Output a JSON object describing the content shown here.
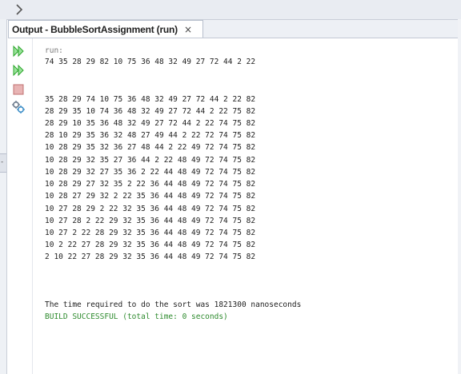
{
  "toolbar_top": {
    "chevron_icon": "chevron-right-icon"
  },
  "tab": {
    "label": "Output - BubbleSortAssignment (run)",
    "close": "×"
  },
  "side_toolbar": {
    "buttons": [
      {
        "icon": "rerun-icon",
        "color": "#2aa52a"
      },
      {
        "icon": "rerun-with-options-icon",
        "color": "#2aa52a"
      },
      {
        "icon": "stop-icon",
        "color": "#d06060"
      },
      {
        "icon": "settings-icon",
        "color": "#6b7a8c"
      }
    ]
  },
  "console": {
    "run": "run:",
    "unsorted": "74 35 28 29 82 10 75 36 48 32 49 27 72 44 2 22",
    "passes": [
      "35 28 29 74 10 75 36 48 32 49 27 72 44 2 22 82",
      "28 29 35 10 74 36 48 32 49 27 72 44 2 22 75 82",
      "28 29 10 35 36 48 32 49 27 72 44 2 22 74 75 82",
      "28 10 29 35 36 32 48 27 49 44 2 22 72 74 75 82",
      "10 28 29 35 32 36 27 48 44 2 22 49 72 74 75 82",
      "10 28 29 32 35 27 36 44 2 22 48 49 72 74 75 82",
      "10 28 29 32 27 35 36 2 22 44 48 49 72 74 75 82",
      "10 28 29 27 32 35 2 22 36 44 48 49 72 74 75 82",
      "10 28 27 29 32 2 22 35 36 44 48 49 72 74 75 82",
      "10 27 28 29 2 22 32 35 36 44 48 49 72 74 75 82",
      "10 27 28 2 22 29 32 35 36 44 48 49 72 74 75 82",
      "10 27 2 22 28 29 32 35 36 44 48 49 72 74 75 82",
      "10 2 22 27 28 29 32 35 36 44 48 49 72 74 75 82",
      "2 10 22 27 28 29 32 35 36 44 48 49 72 74 75 82"
    ],
    "time": "The time required to do the sort was 1821300 nanoseconds",
    "build": "BUILD SUCCESSFUL (total time: 0 seconds)"
  }
}
